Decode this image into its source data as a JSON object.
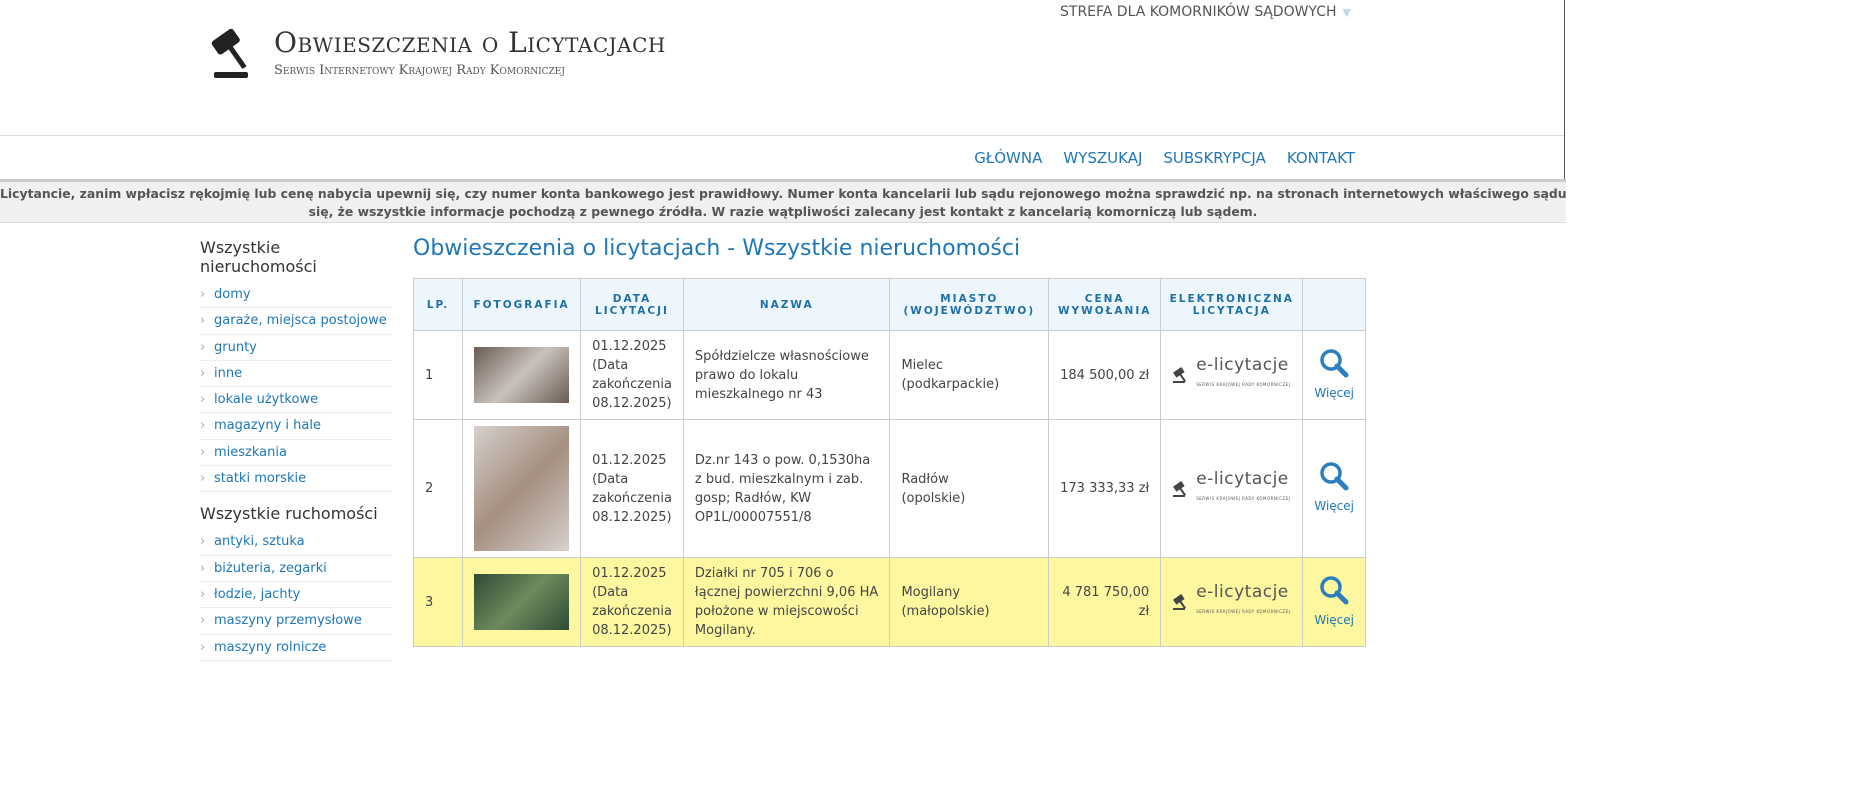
{
  "header": {
    "title": "Obwieszczenia o Licytacjach",
    "subtitle": "Serwis Internetowy Krajowej Rady Komorniczej",
    "zone": "STREFA DLA KOMORNIKÓW SĄDOWYCH"
  },
  "nav": [
    "GŁÓWNA",
    "WYSZUKAJ",
    "SUBSKRYPCJA",
    "KONTAKT"
  ],
  "banner": {
    "line1": "Licytancie, zanim wpłacisz rękojmię lub cenę nabycia upewnij się, czy numer konta bankowego jest prawidłowy. Numer konta kancelarii lub sądu rejonowego można sprawdzić np. na stronach internetowych właściwego sądu rejonowego. Upewnij",
    "line2": "się, że wszystkie informacje pochodzą z pewnego źródła. W razie wątpliwości zalecany jest kontakt z kancelarią komorniczą lub sądem."
  },
  "sidebar": {
    "groups": [
      {
        "title": "Wszystkie nieruchomości",
        "items": [
          "domy",
          "garaże, miejsca postojowe",
          "grunty",
          "inne",
          "lokale użytkowe",
          "magazyny i hale",
          "mieszkania",
          "statki morskie"
        ]
      },
      {
        "title": "Wszystkie ruchomości",
        "items": [
          "antyki, sztuka",
          "biżuteria, zegarki",
          "łodzie, jachty",
          "maszyny przemysłowe",
          "maszyny rolnicze"
        ]
      }
    ]
  },
  "main": {
    "title": "Obwieszczenia o licytacjach - Wszystkie nieruchomości",
    "columns": [
      "LP.",
      "FOTOGRAFIA",
      "DATA LICYTACJI",
      "NAZWA",
      "MIASTO (WOJEWÓDZTWO)",
      "CENA WYWOŁANIA",
      "ELEKTRONICZNA LICYTACJA",
      ""
    ],
    "elic": {
      "name": "e-licytacje",
      "sub": "SERWIS KRAJOWEJ RADY KOMORNICZEJ"
    },
    "more_label": "Więcej",
    "rows": [
      {
        "lp": "1",
        "date": "01.12.2025",
        "end": "(Data zakończenia 08.12.2025)",
        "name": "Spółdzielcze własnościowe prawo do lokalu mieszkalnego nr 43",
        "city": "Mielec",
        "region": "(podkarpackie)",
        "price": "184 500,00 zł"
      },
      {
        "lp": "2",
        "date": "01.12.2025",
        "end": "(Data zakończenia 08.12.2025)",
        "name": "Dz.nr 143 o pow. 0,1530ha z bud. mieszkalnym i zab. gosp; Radłów, KW OP1L/00007551/8",
        "city": "Radłów",
        "region": "(opolskie)",
        "price": "173 333,33 zł"
      },
      {
        "lp": "3",
        "date": "01.12.2025",
        "end": "(Data zakończenia 08.12.2025)",
        "name": "Działki nr 705 i 706 o łącznej powierzchni 9,06 HA położone w miejscowości Mogilany.",
        "city": "Mogilany",
        "region": "(małopolskie)",
        "price": "4 781 750,00 zł"
      }
    ]
  }
}
